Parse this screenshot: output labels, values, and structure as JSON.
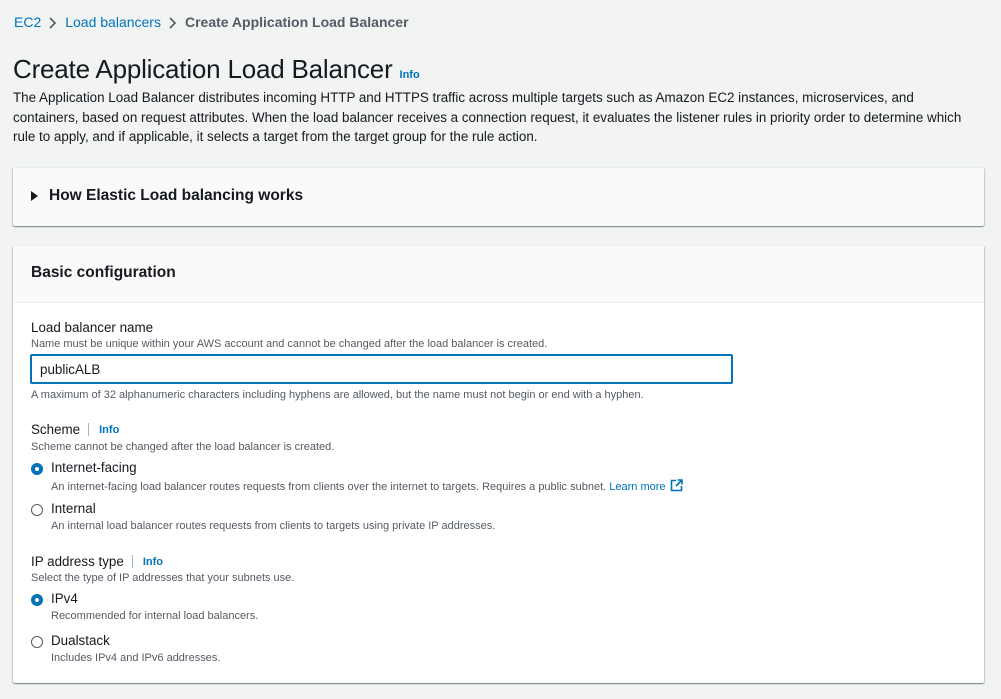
{
  "breadcrumb": {
    "items": [
      "EC2",
      "Load balancers"
    ],
    "current": "Create Application Load Balancer"
  },
  "page": {
    "title": "Create Application Load Balancer",
    "info": "Info",
    "description": "The Application Load Balancer distributes incoming HTTP and HTTPS traffic across multiple targets such as Amazon EC2 instances, microservices, and containers, based on request attributes. When the load balancer receives a connection request, it evaluates the listener rules in priority order to determine which rule to apply, and if applicable, it selects a target from the target group for the rule action."
  },
  "how_section": {
    "title": "How Elastic Load balancing works",
    "expanded": false
  },
  "basic": {
    "title": "Basic configuration",
    "name_label": "Load balancer name",
    "name_desc": "Name must be unique within your AWS account and cannot be changed after the load balancer is created.",
    "name_value": "publicALB",
    "name_constraint": "A maximum of 32 alphanumeric characters including hyphens are allowed, but the name must not begin or end with a hyphen.",
    "scheme_label": "Scheme",
    "scheme_info": "Info",
    "scheme_desc": "Scheme cannot be changed after the load balancer is created.",
    "scheme_options": [
      {
        "label": "Internet-facing",
        "desc": "An internet-facing load balancer routes requests from clients over the internet to targets. Requires a public subnet.",
        "link": "Learn more",
        "selected": true
      },
      {
        "label": "Internal",
        "desc": "An internal load balancer routes requests from clients to targets using private IP addresses.",
        "selected": false
      }
    ],
    "ip_label": "IP address type",
    "ip_info": "Info",
    "ip_desc": "Select the type of IP addresses that your subnets use.",
    "ip_options": [
      {
        "label": "IPv4",
        "desc": "Recommended for internal load balancers.",
        "selected": true
      },
      {
        "label": "Dualstack",
        "desc": "Includes IPv4 and IPv6 addresses.",
        "selected": false
      }
    ]
  },
  "colors": {
    "link": "#0073bb",
    "text": "#16191f",
    "muted": "#545b64",
    "background": "#f2f3f3"
  },
  "icons": {
    "separator": "chevron-right-icon",
    "expand": "caret-right-icon",
    "external": "external-link-icon"
  }
}
